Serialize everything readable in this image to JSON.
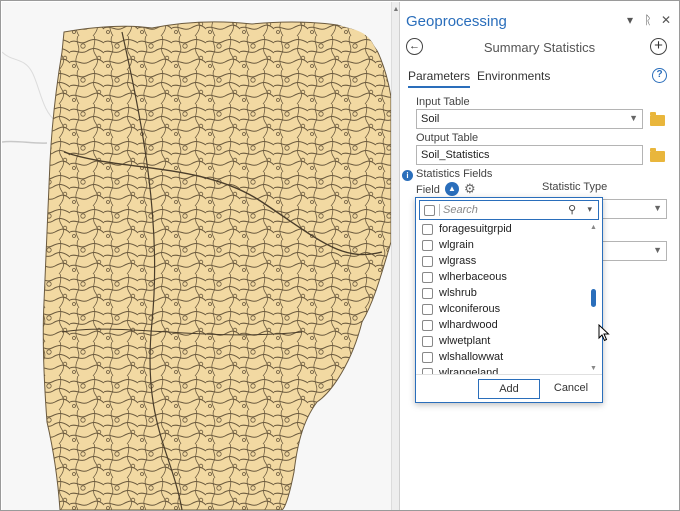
{
  "pane": {
    "title": "Geoprocessing",
    "title_icons": [
      "chevron-down",
      "pin",
      "close"
    ],
    "tool_name": "Summary Statistics",
    "tabs": [
      "Parameters",
      "Environments"
    ],
    "help": "?"
  },
  "params": {
    "input_table_label": "Input Table",
    "input_table_value": "Soil",
    "output_table_label": "Output Table",
    "output_table_value": "Soil_Statistics",
    "statistics_fields_label": "Statistics Fields",
    "field_col": "Field",
    "statistic_type_col": "Statistic Type"
  },
  "picker": {
    "search_placeholder": "Search",
    "items": [
      "foragesuitgrpid",
      "wlgrain",
      "wlgrass",
      "wlherbaceous",
      "wlshrub",
      "wlconiferous",
      "wlhardwood",
      "wlwetplant",
      "wlshallowwat",
      "wlrangeland"
    ],
    "scroll_position": 0.5,
    "add_label": "Add",
    "cancel_label": "Cancel"
  },
  "colors": {
    "accent": "#2a6ebb",
    "soil_fill": "#f2d9a2",
    "soil_line": "#6b5a3e",
    "folder": "#e9b63c"
  },
  "icons": {
    "back": "arrow-left-circle-icon",
    "add_tool": "plus-circle-icon",
    "help": "help-icon",
    "folder": "folder-icon",
    "search": "search-icon",
    "settings": "gear-icon"
  }
}
